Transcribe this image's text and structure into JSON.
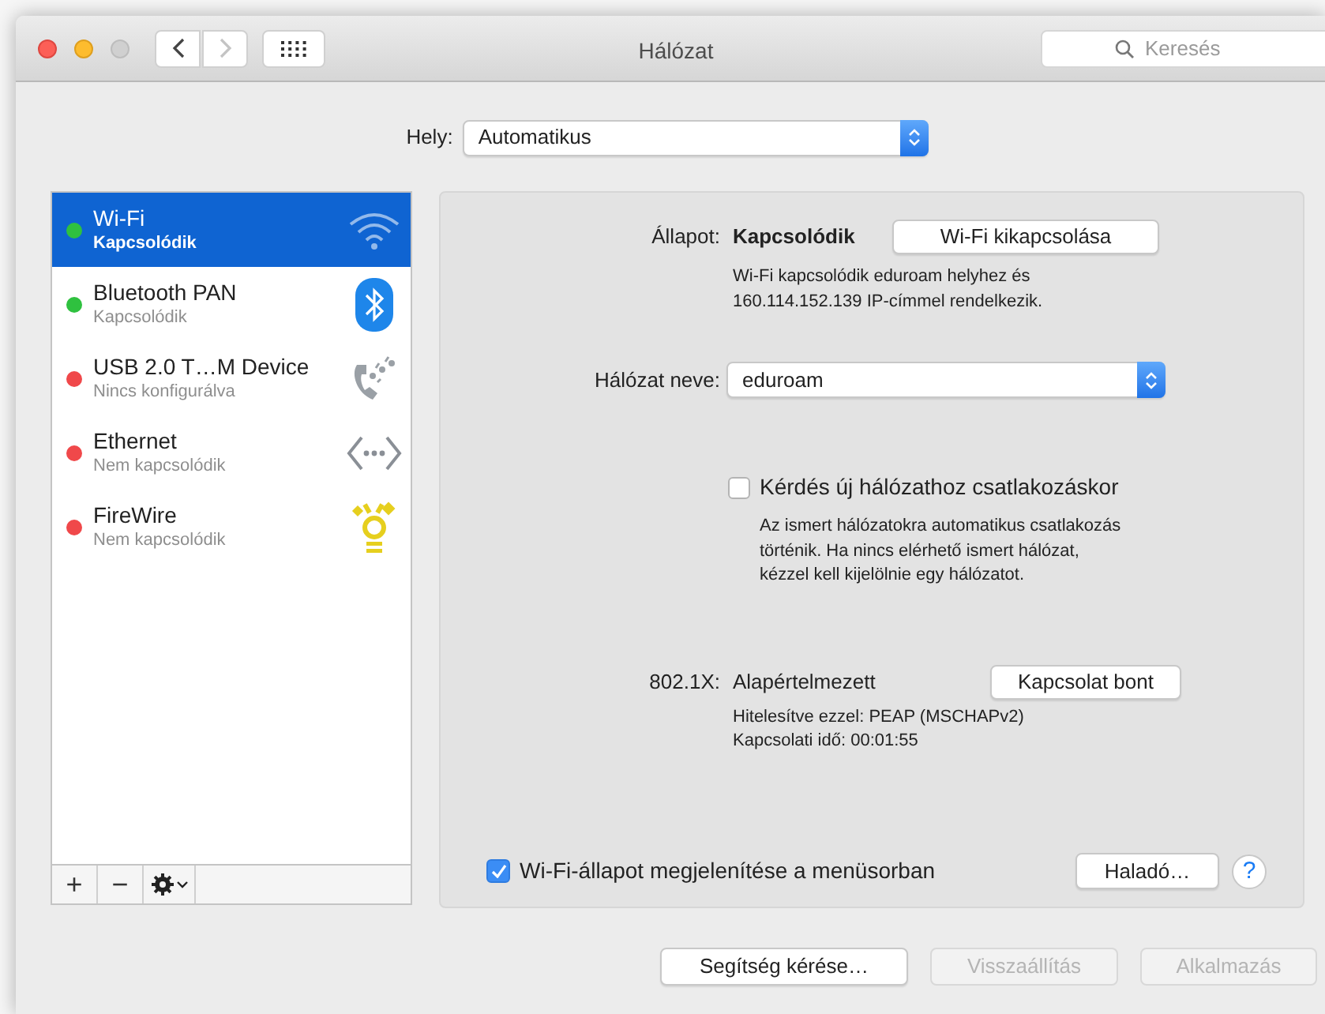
{
  "window": {
    "title": "Hálózat"
  },
  "search": {
    "placeholder": "Keresés"
  },
  "location": {
    "label": "Hely:",
    "value": "Automatikus"
  },
  "services": [
    {
      "name": "Wi-Fi",
      "status": "Kapcsolódik",
      "color": "#2fc13f",
      "kind": "wifi",
      "selected": true
    },
    {
      "name": "Bluetooth PAN",
      "status": "Kapcsolódik",
      "color": "#2fc13f",
      "kind": "bluetooth",
      "selected": false
    },
    {
      "name": "USB 2.0 T…M Device",
      "status": "Nincs konfigurálva",
      "color": "#f0484a",
      "kind": "modem",
      "selected": false
    },
    {
      "name": "Ethernet",
      "status": "Nem kapcsolódik",
      "color": "#f0484a",
      "kind": "ethernet",
      "selected": false
    },
    {
      "name": "FireWire",
      "status": "Nem kapcsolódik",
      "color": "#f0484a",
      "kind": "firewire",
      "selected": false
    }
  ],
  "sidebar_toolbar": {
    "add": "+",
    "remove": "−"
  },
  "status": {
    "label": "Állapot:",
    "value": "Kapcsolódik",
    "button": "Wi-Fi kikapcsolása",
    "description": [
      "Wi-Fi kapcsolódik eduroam helyhez és",
      "160.114.152.139 IP-címmel rendelkezik."
    ]
  },
  "network_name": {
    "label": "Hálózat neve:",
    "value": "eduroam"
  },
  "ask_to_join": {
    "label": "Kérdés új hálózathoz csatlakozáskor",
    "checked": false,
    "description": [
      "Az ismert hálózatokra automatikus csatlakozás",
      "történik. Ha nincs elérhető ismert hálózat,",
      "kézzel kell kijelölnie egy hálózatot."
    ]
  },
  "dot1x": {
    "label": "802.1X:",
    "value": "Alapértelmezett",
    "button": "Kapcsolat bont",
    "details": [
      "Hitelesítve ezzel: PEAP (MSCHAPv2)",
      "Kapcsolati idő: 00:01:55"
    ]
  },
  "show_in_menu": {
    "label": "Wi-Fi-állapot megjelenítése a menüsorban",
    "checked": true
  },
  "advanced_button": "Haladó…",
  "help_button": "?",
  "footer_buttons": [
    {
      "label": "Segítség kérése…",
      "disabled": false
    },
    {
      "label": "Visszaállítás",
      "disabled": true
    },
    {
      "label": "Alkalmazás",
      "disabled": true
    }
  ]
}
